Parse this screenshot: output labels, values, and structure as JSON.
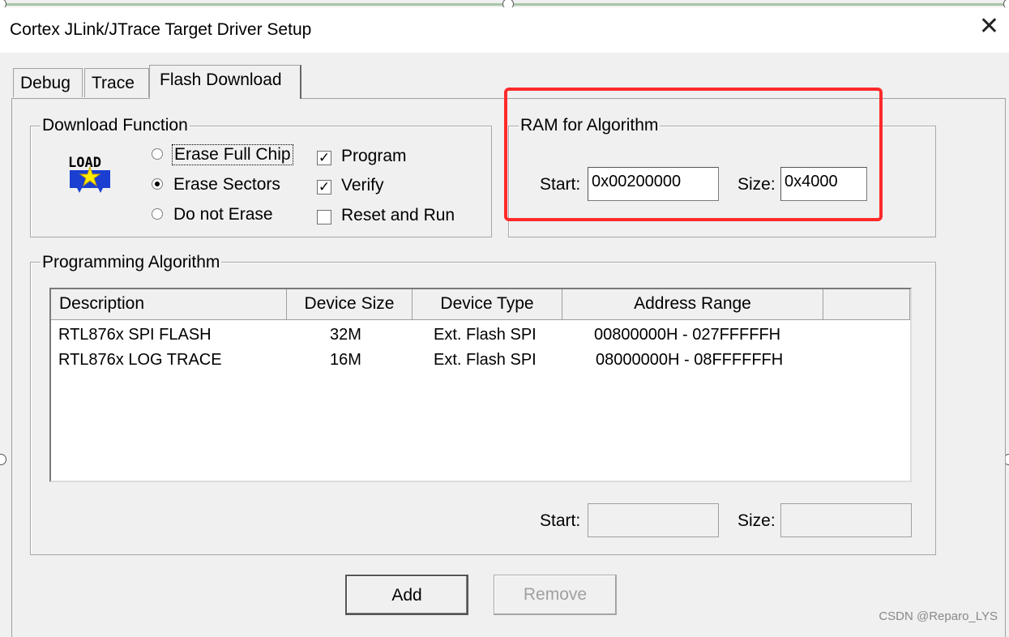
{
  "window": {
    "title": "Cortex JLink/JTrace Target Driver Setup",
    "close_glyph": "✕"
  },
  "tabs": [
    {
      "label": "Debug"
    },
    {
      "label": "Trace"
    },
    {
      "label": "Flash Download",
      "active": true
    }
  ],
  "download_function": {
    "legend": "Download Function",
    "icon": "load-icon",
    "icon_text": "LOAD",
    "radios": [
      {
        "label": "Erase Full Chip",
        "selected": false
      },
      {
        "label": "Erase Sectors",
        "selected": true
      },
      {
        "label": "Do not Erase",
        "selected": false
      }
    ],
    "checkboxes": [
      {
        "label": "Program",
        "checked": true,
        "mark": "✓"
      },
      {
        "label": "Verify",
        "checked": true,
        "mark": "✓"
      },
      {
        "label": "Reset and Run",
        "checked": false,
        "mark": ""
      }
    ]
  },
  "ram_for_algorithm": {
    "legend": "RAM for Algorithm",
    "start_label": "Start:",
    "start_value": "0x00200000",
    "size_label": "Size:",
    "size_value": "0x4000"
  },
  "programming_algorithm": {
    "legend": "Programming Algorithm",
    "columns": [
      "Description",
      "Device Size",
      "Device Type",
      "Address Range"
    ],
    "rows": [
      {
        "description": "RTL876x SPI FLASH",
        "device_size": "32M",
        "device_type": "Ext. Flash SPI",
        "address_range": "00800000H - 027FFFFFH"
      },
      {
        "description": "RTL876x LOG TRACE",
        "device_size": "16M",
        "device_type": "Ext. Flash SPI",
        "address_range": "08000000H - 08FFFFFFH"
      }
    ],
    "start_label": "Start:",
    "start_value": "",
    "size_label": "Size:",
    "size_value": ""
  },
  "buttons": {
    "add": "Add",
    "remove": "Remove"
  },
  "watermark": "CSDN @Reparo_LYS",
  "colors": {
    "highlight_box": "#ff2a2a",
    "selection_line": "#a9c4a9"
  }
}
